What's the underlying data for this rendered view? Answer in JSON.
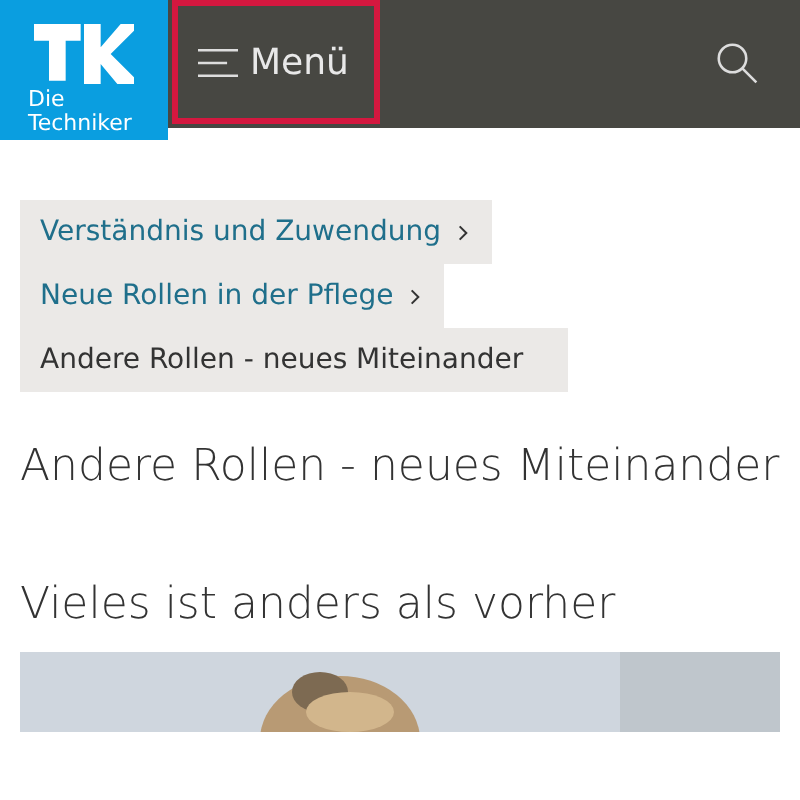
{
  "header": {
    "logo_text": "Die Techniker",
    "menu_button": {
      "label": "Menü",
      "focused": true
    }
  },
  "breadcrumbs": [
    {
      "label": "Verständnis und Zuwendung",
      "current": false
    },
    {
      "label": "Neue Rollen in der Pflege",
      "current": false
    },
    {
      "label": "Andere Rollen - neues Miteinander",
      "current": true
    }
  ],
  "title": "Andere Rollen - neues Miteinander",
  "subheading": "Vieles ist anders als vorher"
}
